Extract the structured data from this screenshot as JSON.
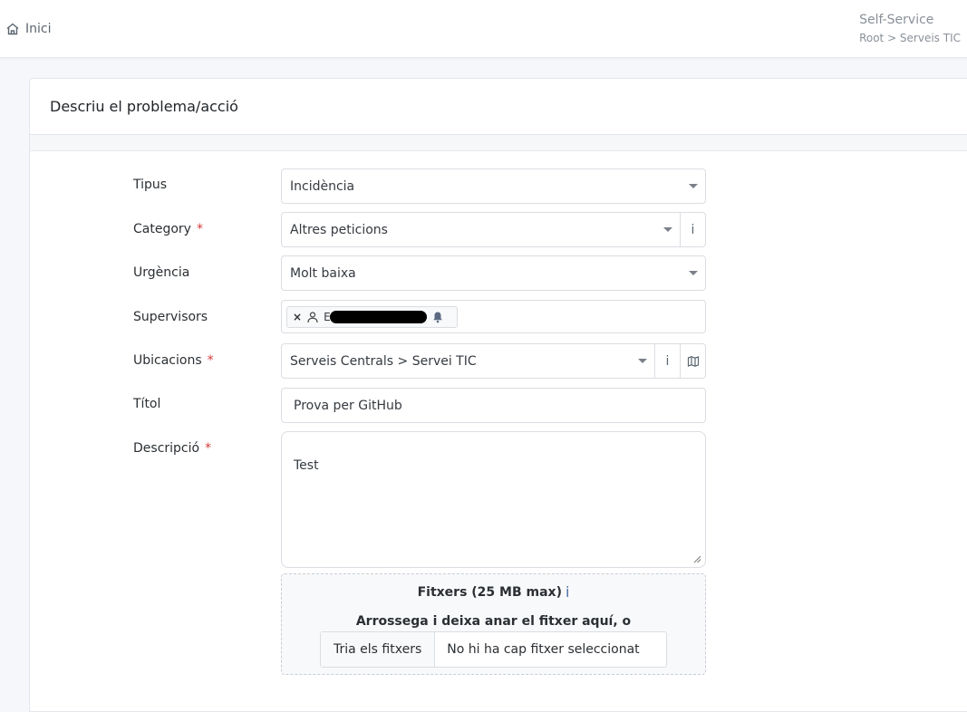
{
  "topbar": {
    "home_label": "Inici",
    "context_title": "Self-Service",
    "context_path": "Root > Serveis TIC"
  },
  "form": {
    "title": "Descriu el problema/acció",
    "fields": {
      "tipus": {
        "label": "Tipus",
        "value": "Incidència"
      },
      "category": {
        "label": "Category",
        "required_mark": "*",
        "value": "Altres peticions"
      },
      "urgencia": {
        "label": "Urgència",
        "value": "Molt baixa"
      },
      "supervisors": {
        "label": "Supervisors",
        "tag_remove": "×",
        "tag_initial": "E"
      },
      "ubicacions": {
        "label": "Ubicacions",
        "required_mark": "*",
        "value": "Serveis Centrals > Servei TIC"
      },
      "titol": {
        "label": "Títol",
        "value": "Prova per GitHub"
      },
      "descripcio": {
        "label": "Descripció",
        "required_mark": "*",
        "value": "Test"
      }
    },
    "attachments": {
      "title": "Fitxers (25 MB max)",
      "info_glyph": "i",
      "hint": "Arrossega i deixa anar el fitxer aquí, o",
      "choose_label": "Tria els fitxers",
      "status": "No hi ha cap fitxer seleccionat"
    },
    "info_glyph": "i"
  }
}
